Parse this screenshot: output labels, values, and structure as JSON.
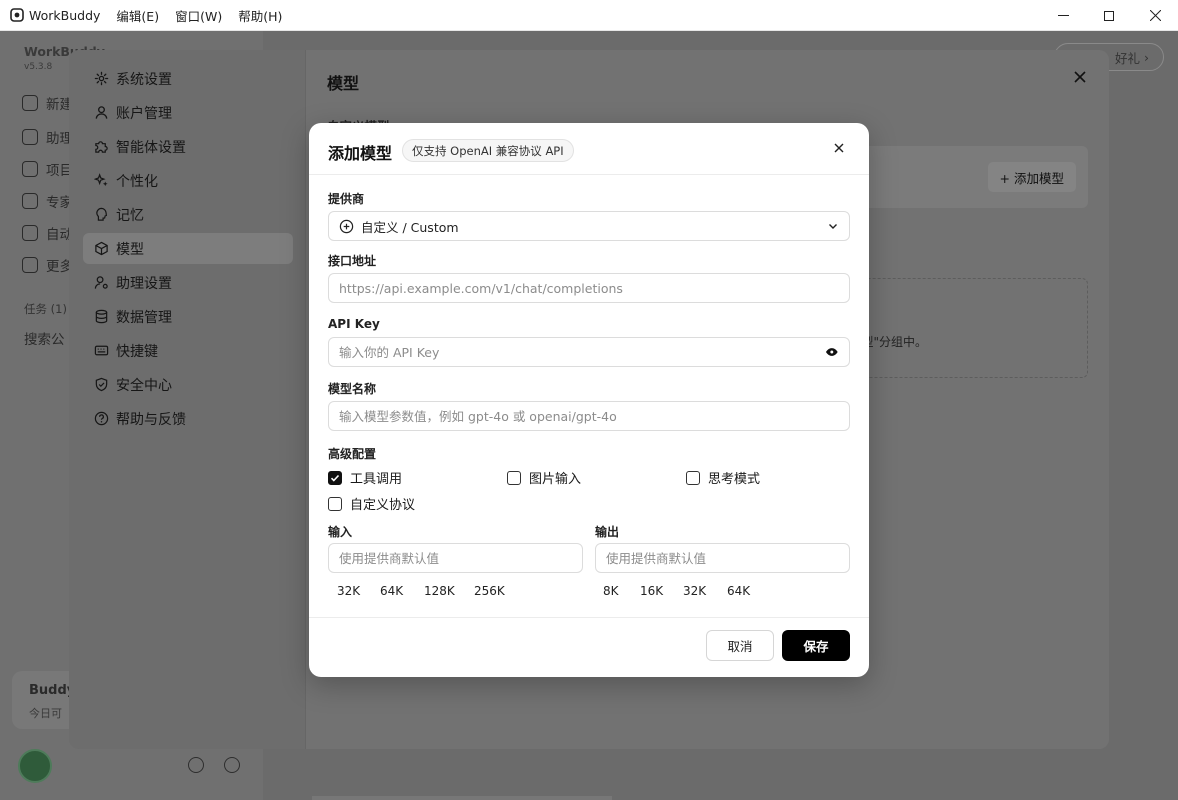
{
  "titlebar": {
    "app_name": "WorkBuddy",
    "menus": [
      "编辑(E)",
      "窗口(W)",
      "帮助(H)"
    ]
  },
  "background": {
    "brand": "WorkBuddy",
    "version": "v5.3.8",
    "nav": [
      "新建",
      "助理",
      "项目",
      "专家",
      "自动",
      "更多"
    ],
    "tasks_label": "任务 (1)",
    "search_label": "搜索公",
    "gift_label": "好礼",
    "buddy_title": "Buddy",
    "buddy_sub": "今日可"
  },
  "settings": {
    "nav": [
      {
        "label": "系统设置",
        "icon": "gear-icon"
      },
      {
        "label": "账户管理",
        "icon": "user-icon"
      },
      {
        "label": "智能体设置",
        "icon": "puzzle-icon"
      },
      {
        "label": "个性化",
        "icon": "sparkle-icon"
      },
      {
        "label": "记忆",
        "icon": "brain-icon"
      },
      {
        "label": "模型",
        "icon": "cube-icon"
      },
      {
        "label": "助理设置",
        "icon": "user-gear-icon"
      },
      {
        "label": "数据管理",
        "icon": "database-icon"
      },
      {
        "label": "快捷键",
        "icon": "keyboard-icon"
      },
      {
        "label": "安全中心",
        "icon": "shield-icon"
      },
      {
        "label": "帮助与反馈",
        "icon": "help-icon"
      }
    ],
    "active_index": 5,
    "title": "模型",
    "custom_label": "自定义模型",
    "add_model_label": "+ 添加模型",
    "empty_hint": "型\"分组中。"
  },
  "dialog": {
    "title": "添加模型",
    "tag": "仅支持 OpenAI 兼容协议 API",
    "provider_label": "提供商",
    "provider_value": "自定义 / Custom",
    "endpoint_label": "接口地址",
    "endpoint_placeholder": "https://api.example.com/v1/chat/completions",
    "apikey_label": "API Key",
    "apikey_placeholder": "输入你的 API Key",
    "model_name_label": "模型名称",
    "model_name_placeholder": "输入模型参数值，例如 gpt-4o 或 openai/gpt-4o",
    "advanced_label": "高级配置",
    "checkboxes": [
      {
        "label": "工具调用",
        "checked": true
      },
      {
        "label": "图片输入",
        "checked": false
      },
      {
        "label": "思考模式",
        "checked": false
      },
      {
        "label": "自定义协议",
        "checked": false
      }
    ],
    "input_label": "输入",
    "input_placeholder": "使用提供商默认值",
    "input_chips": [
      "32K",
      "64K",
      "128K",
      "256K"
    ],
    "output_label": "输出",
    "output_placeholder": "使用提供商默认值",
    "output_chips": [
      "8K",
      "16K",
      "32K",
      "64K"
    ],
    "cancel_label": "取消",
    "save_label": "保存"
  },
  "colors": {
    "primary_button": "#000000",
    "overlay": "#6f6f6f"
  }
}
